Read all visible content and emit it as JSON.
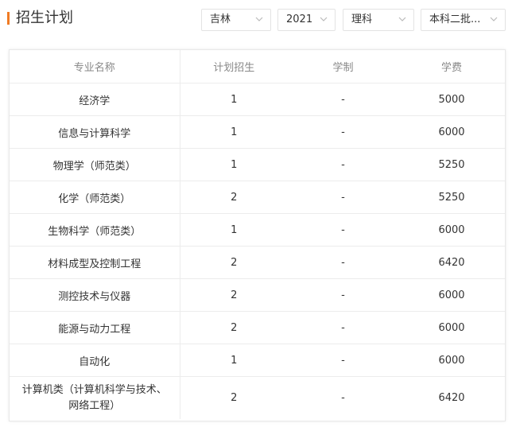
{
  "header": {
    "title": "招生计划"
  },
  "filters": {
    "province": "吉林",
    "year": "2021",
    "subject": "理科",
    "batch": "本科二批..."
  },
  "table": {
    "columns": [
      "专业名称",
      "计划招生",
      "学制",
      "学费"
    ],
    "rows": [
      {
        "major": "经济学",
        "plan": "1",
        "duration": "-",
        "fee": "5000"
      },
      {
        "major": "信息与计算科学",
        "plan": "1",
        "duration": "-",
        "fee": "6000"
      },
      {
        "major": "物理学（师范类）",
        "plan": "1",
        "duration": "-",
        "fee": "5250"
      },
      {
        "major": "化学（师范类）",
        "plan": "2",
        "duration": "-",
        "fee": "5250"
      },
      {
        "major": "生物科学（师范类）",
        "plan": "1",
        "duration": "-",
        "fee": "6000"
      },
      {
        "major": "材料成型及控制工程",
        "plan": "2",
        "duration": "-",
        "fee": "6420"
      },
      {
        "major": "测控技术与仪器",
        "plan": "2",
        "duration": "-",
        "fee": "6000"
      },
      {
        "major": "能源与动力工程",
        "plan": "2",
        "duration": "-",
        "fee": "6000"
      },
      {
        "major": "自动化",
        "plan": "1",
        "duration": "-",
        "fee": "6000"
      },
      {
        "major": "计算机类（计算机科学与技术、网络工程）",
        "plan": "2",
        "duration": "-",
        "fee": "6420"
      }
    ]
  },
  "colors": {
    "accent": "#f07b24",
    "border": "#ececec",
    "header_text": "#888888"
  }
}
